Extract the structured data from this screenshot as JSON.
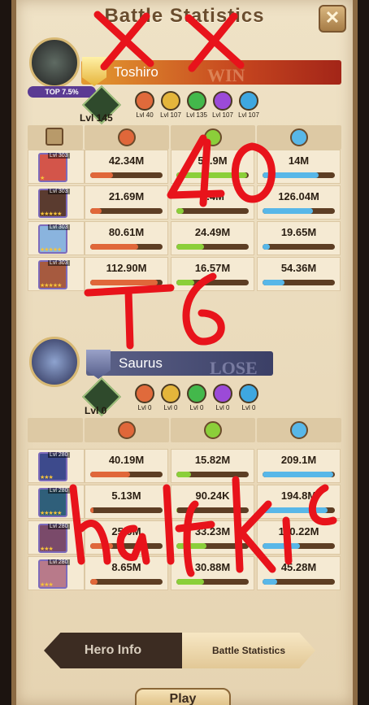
{
  "title": "Battle Statistics",
  "close_symbol": "✕",
  "ally": {
    "name": "Toshiro",
    "top_badge": "TOP 7.5%",
    "result": "WIN",
    "tree_level": "Lvl 145",
    "pets": [
      {
        "level": "Lvl 40",
        "color": "#e06a3b"
      },
      {
        "level": "Lvl 107",
        "color": "#e4b53b"
      },
      {
        "level": "Lvl 135",
        "color": "#43b84b"
      },
      {
        "level": "Lvl 107",
        "color": "#9b4ad8"
      },
      {
        "level": "Lvl 107",
        "color": "#3ea7e0"
      }
    ],
    "heroes": [
      {
        "level": "Lvl 303",
        "stars": "★",
        "damage": "42.34M",
        "heal": "59.9M",
        "shield": "14M",
        "dmg_pct": 0.32,
        "heal_pct": 0.98,
        "shield_pct": 0.78,
        "color": "#d3554a"
      },
      {
        "level": "Lvl 303",
        "stars": "★★★★★",
        "damage": "21.69M",
        "heal": "6.4M",
        "shield": "126.04M",
        "dmg_pct": 0.16,
        "heal_pct": 0.1,
        "shield_pct": 0.7,
        "color": "#5a3b2f"
      },
      {
        "level": "Lvl 303",
        "stars": "★★★★★",
        "damage": "80.61M",
        "heal": "24.49M",
        "shield": "19.65M",
        "dmg_pct": 0.66,
        "heal_pct": 0.38,
        "shield_pct": 0.1,
        "color": "#8ab4de"
      },
      {
        "level": "Lvl 303",
        "stars": "★★★★★",
        "damage": "112.90M",
        "heal": "16.57M",
        "shield": "54.36M",
        "dmg_pct": 0.93,
        "heal_pct": 0.25,
        "shield_pct": 0.3,
        "color": "#a65a3f"
      }
    ]
  },
  "enemy": {
    "name": "Saurus",
    "result": "LOSE",
    "tree_level": "Lvl 0",
    "pets": [
      {
        "level": "Lvl 0",
        "color": "#e06a3b"
      },
      {
        "level": "Lvl 0",
        "color": "#e4b53b"
      },
      {
        "level": "Lvl 0",
        "color": "#43b84b"
      },
      {
        "level": "Lvl 0",
        "color": "#9b4ad8"
      },
      {
        "level": "Lvl 0",
        "color": "#3ea7e0"
      }
    ],
    "heroes": [
      {
        "level": "Lvl 280",
        "stars": "★★★",
        "damage": "40.19M",
        "heal": "15.82M",
        "shield": "209.1M",
        "dmg_pct": 0.55,
        "heal_pct": 0.2,
        "shield_pct": 0.98,
        "color": "#3d4a8c"
      },
      {
        "level": "Lvl 280",
        "stars": "★★★★★",
        "damage": "5.13M",
        "heal": "90.24K",
        "shield": "194.8M",
        "dmg_pct": 0.05,
        "heal_pct": 0.01,
        "shield_pct": 0.9,
        "color": "#2f5f7a"
      },
      {
        "level": "Lvl 280",
        "stars": "★★★",
        "damage": "25.0M",
        "heal": "33.23M",
        "shield": "110.22M",
        "dmg_pct": 0.32,
        "heal_pct": 0.42,
        "shield_pct": 0.52,
        "color": "#7a4a6a"
      },
      {
        "level": "Lvl 280",
        "stars": "★★★",
        "damage": "8.65M",
        "heal": "30.88M",
        "shield": "45.28M",
        "dmg_pct": 0.1,
        "heal_pct": 0.38,
        "shield_pct": 0.2,
        "color": "#b87a8a"
      }
    ]
  },
  "tabs": {
    "hero_info": "Hero Info",
    "battle_statistics": "Battle Statistics"
  },
  "play_label": "Play",
  "annotations": [
    "X X",
    "40",
    "T6",
    "half kill"
  ],
  "colors": {
    "damage": "#e0673a",
    "heal": "#8bcf3a",
    "shield": "#58b7e8",
    "scribble": "#e8131b"
  },
  "icons": {
    "damage": "fist-icon",
    "heal": "heal-swirl-icon",
    "shield": "shield-icon",
    "tree": "tree-icon",
    "scroll": "scroll-icon"
  }
}
